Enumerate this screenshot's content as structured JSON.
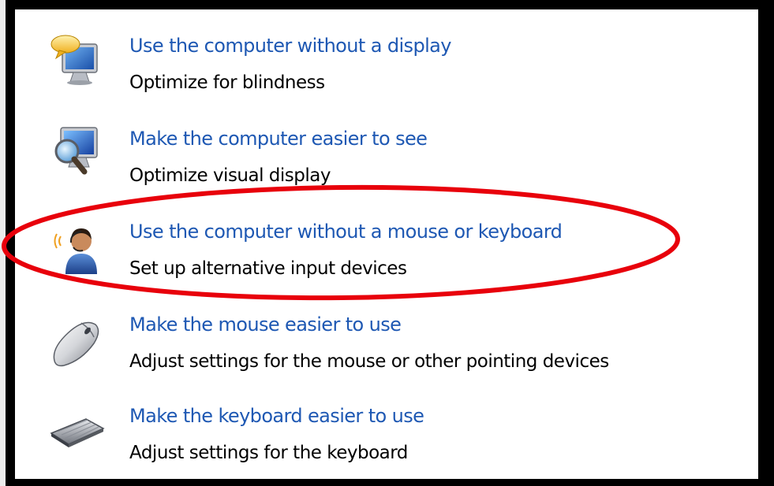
{
  "items": [
    {
      "icon": "speech-bubble-monitor-icon",
      "link": "Use the computer without a display",
      "description": "Optimize for blindness"
    },
    {
      "icon": "magnifier-monitor-icon",
      "link": "Make the computer easier to see",
      "description": "Optimize visual display"
    },
    {
      "icon": "person-headset-icon",
      "link": "Use the computer without a mouse or keyboard",
      "description": "Set up alternative input devices"
    },
    {
      "icon": "mouse-icon",
      "link": "Make the mouse easier to use",
      "description": "Adjust settings for the mouse or other pointing devices"
    },
    {
      "icon": "keyboard-icon",
      "link": "Make the keyboard easier to use",
      "description": "Adjust settings for the keyboard"
    }
  ],
  "colors": {
    "link": "#1e58b3",
    "highlight": "#e8000b",
    "frame": "#000000",
    "panel": "#ffffff"
  }
}
